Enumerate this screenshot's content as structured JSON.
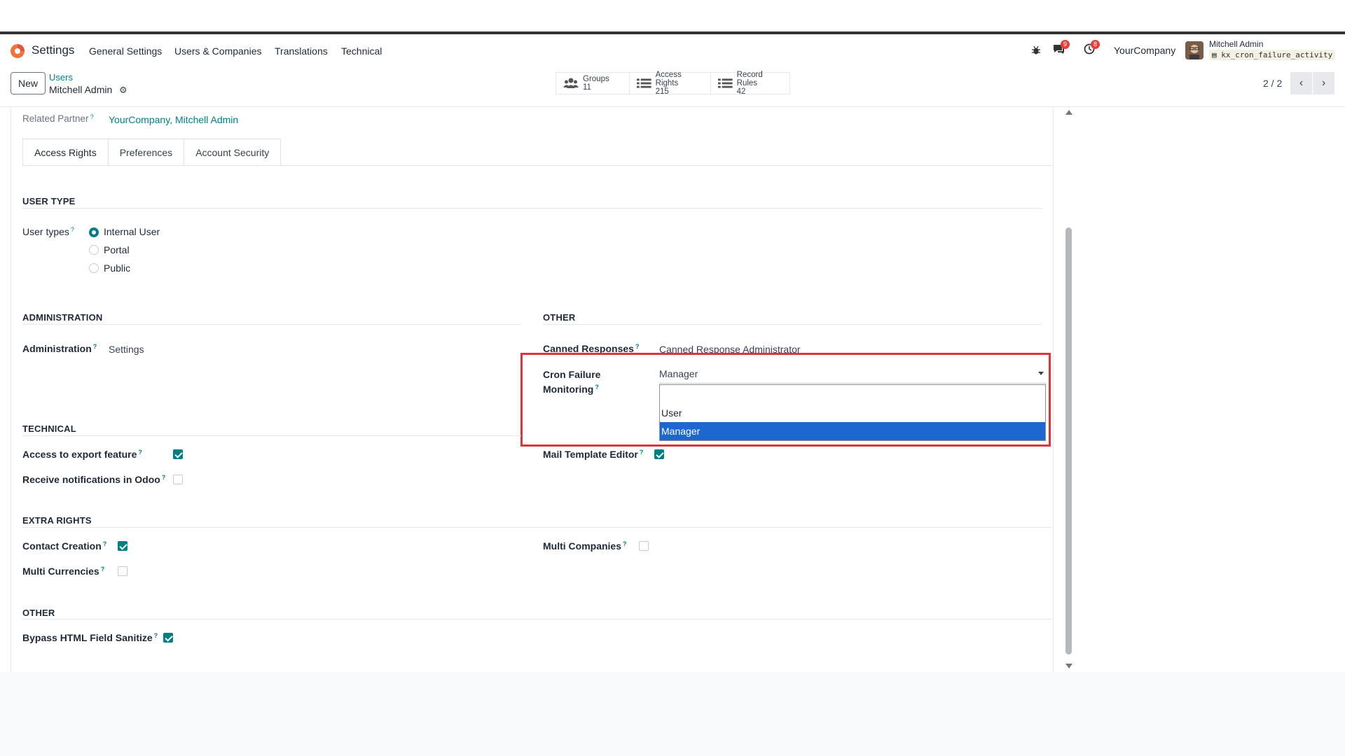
{
  "navbar": {
    "app_name": "Settings",
    "menu": [
      "General Settings",
      "Users & Companies",
      "Translations",
      "Technical"
    ],
    "messages_badge": "9",
    "activities_badge": "8",
    "company": "YourCompany",
    "user_name": "Mitchell Admin",
    "db_name": "kx_cron_failure_activity"
  },
  "control": {
    "new_label": "New",
    "breadcrumb_parent": "Users",
    "breadcrumb_current": "Mitchell Admin",
    "smart_buttons": [
      {
        "label": "Groups",
        "count": "11",
        "icon": "users-icon"
      },
      {
        "label": "Access Rights",
        "count": "215",
        "icon": "list-icon"
      },
      {
        "label": "Record Rules",
        "count": "42",
        "icon": "list-icon"
      }
    ],
    "pager": "2 / 2"
  },
  "form": {
    "related_partner_label": "Related Partner",
    "related_partner_value": "YourCompany, Mitchell Admin",
    "tabs": [
      "Access Rights",
      "Preferences",
      "Account Security"
    ],
    "active_tab": "Access Rights",
    "user_type_section": "USER TYPE",
    "user_types_label": "User types",
    "user_types": [
      "Internal User",
      "Portal",
      "Public"
    ],
    "selected_user_type": "Internal User",
    "administration_section": "ADMINISTRATION",
    "administration_label": "Administration",
    "administration_value": "Settings",
    "other_section": "OTHER",
    "canned_label": "Canned Responses",
    "canned_value": "Canned Response Administrator",
    "cron_label_1": "Cron Failure",
    "cron_label_2": "Monitoring",
    "cron_value": "Manager",
    "cron_options": [
      "",
      "User",
      "Manager"
    ],
    "technical_section": "TECHNICAL",
    "export_label": "Access to export feature",
    "export_checked": true,
    "notif_label": "Receive notifications in Odoo",
    "notif_checked": false,
    "mail_template_label": "Mail Template Editor",
    "mail_template_checked": true,
    "extra_section": "EXTRA RIGHTS",
    "contact_label": "Contact Creation",
    "contact_checked": true,
    "multi_companies_label": "Multi Companies",
    "multi_companies_checked": false,
    "multi_currencies_label": "Multi Currencies",
    "multi_currencies_checked": false,
    "other2_section": "OTHER",
    "bypass_label": "Bypass HTML Field Sanitize",
    "bypass_checked": true
  },
  "colors": {
    "accent": "#017e84",
    "selection": "#1e66d0",
    "highlight": "#e0343d"
  }
}
